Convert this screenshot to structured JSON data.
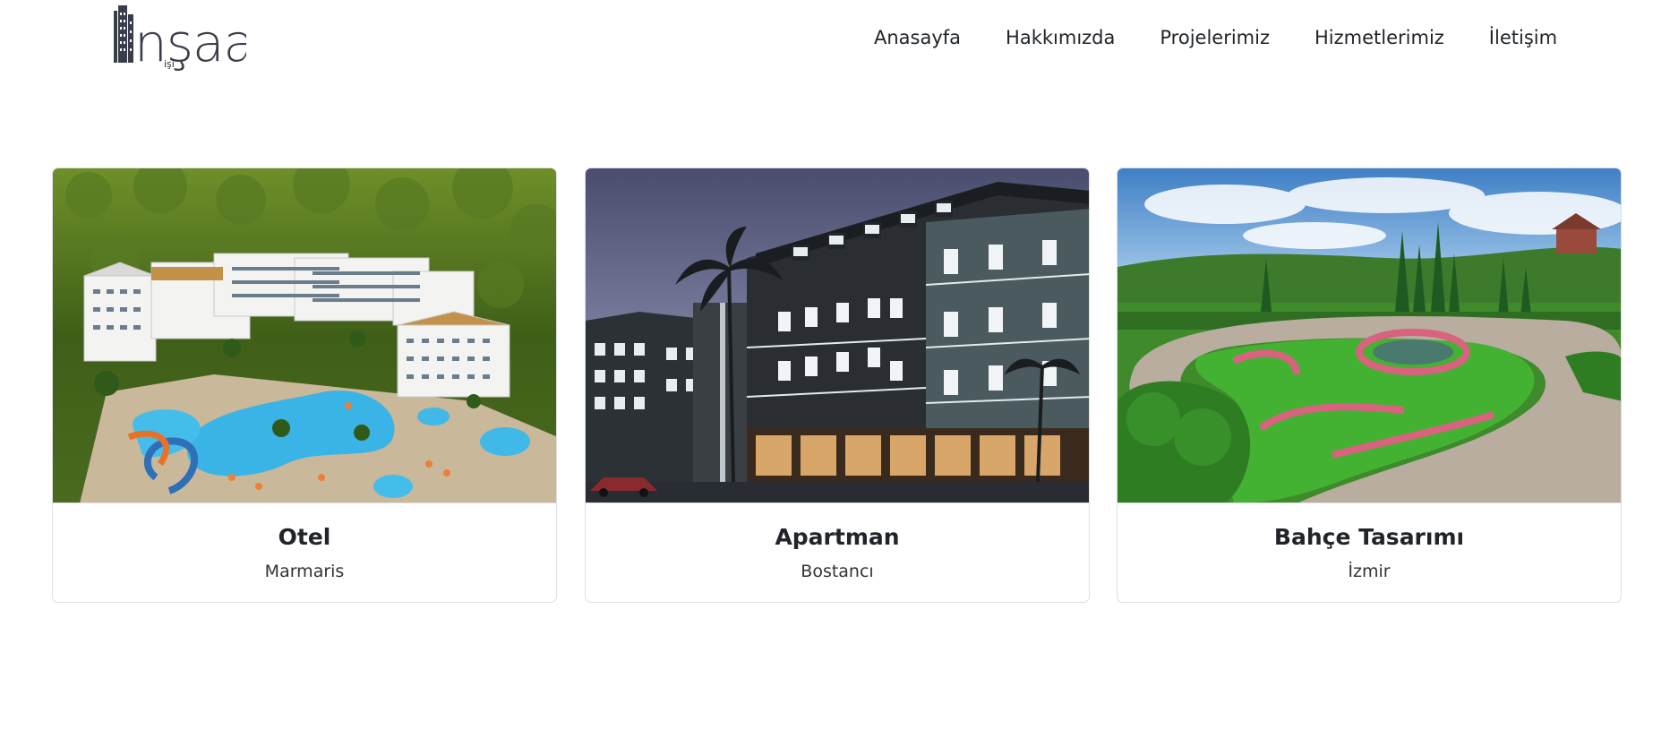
{
  "brand": {
    "logo_text": "nşaat",
    "logo_sub": "işi"
  },
  "nav": {
    "items": [
      {
        "label": "Anasayfa"
      },
      {
        "label": "Hakkımızda"
      },
      {
        "label": "Projelerimiz"
      },
      {
        "label": "Hizmetlerimiz"
      },
      {
        "label": "İletişim"
      }
    ]
  },
  "projects": [
    {
      "title": "Otel",
      "location": "Marmaris",
      "image": "resort-hotel-pool-aerial-photo"
    },
    {
      "title": "Apartman",
      "location": "Bostancı",
      "image": "apartment-building-night-render"
    },
    {
      "title": "Bahçe Tasarımı",
      "location": "İzmir",
      "image": "landscaped-garden-photo"
    }
  ],
  "colors": {
    "text": "#212529",
    "card_border": "#dcdfe3",
    "logo": "#3a3d4a"
  }
}
